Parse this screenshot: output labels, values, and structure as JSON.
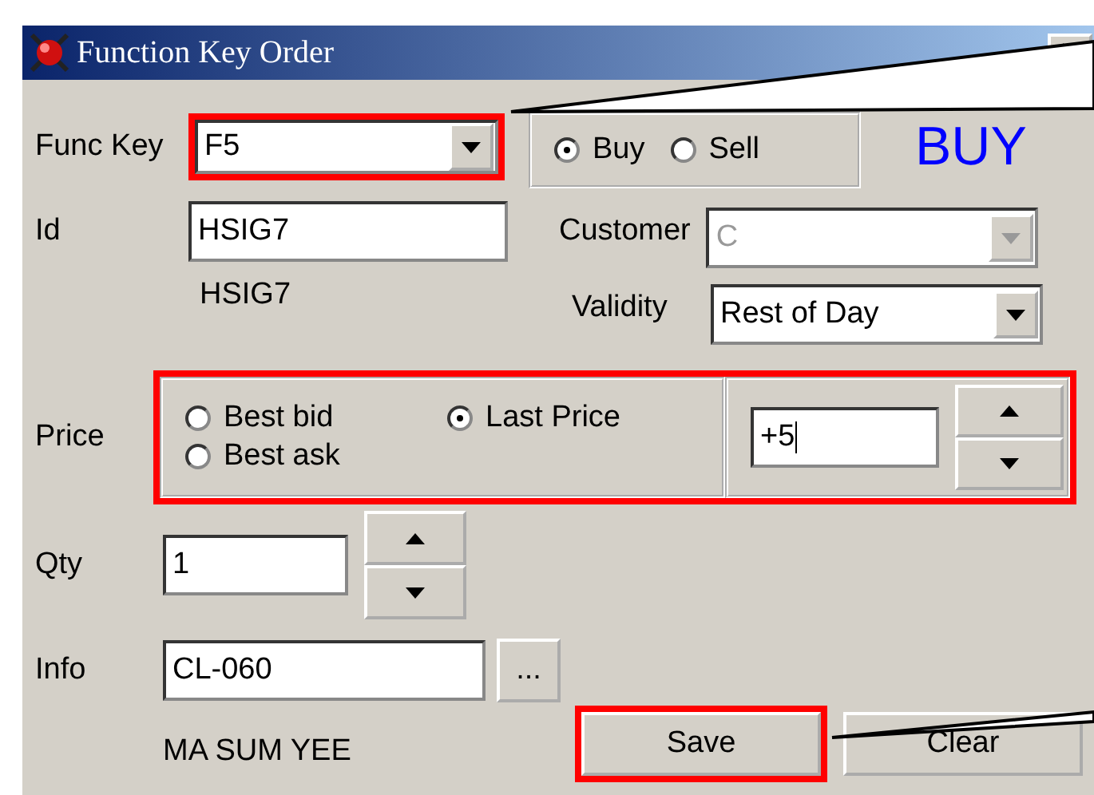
{
  "window": {
    "title": "Function Key Order"
  },
  "func_key": {
    "label": "Func Key",
    "value": "F5",
    "highlighted": true
  },
  "side": {
    "options": [
      {
        "label": "Buy",
        "selected": true
      },
      {
        "label": "Sell",
        "selected": false
      }
    ],
    "display": "BUY"
  },
  "id": {
    "label": "Id",
    "value": "HSIG7",
    "resolved": "HSIG7"
  },
  "customer": {
    "label": "Customer",
    "value": "C",
    "disabled": true
  },
  "validity": {
    "label": "Validity",
    "value": "Rest of Day"
  },
  "price": {
    "label": "Price",
    "highlighted": true,
    "offset": "+5",
    "options": [
      {
        "label": "Best bid",
        "selected": false
      },
      {
        "label": "Last Price",
        "selected": true
      },
      {
        "label": "Best ask",
        "selected": false
      }
    ]
  },
  "qty": {
    "label": "Qty",
    "value": "1"
  },
  "info": {
    "label": "Info",
    "value": "CL-060",
    "browse": "...",
    "name": "MA SUM YEE"
  },
  "buttons": [
    {
      "label": "Save",
      "highlighted": true
    },
    {
      "label": "Clear",
      "highlighted": false
    }
  ]
}
